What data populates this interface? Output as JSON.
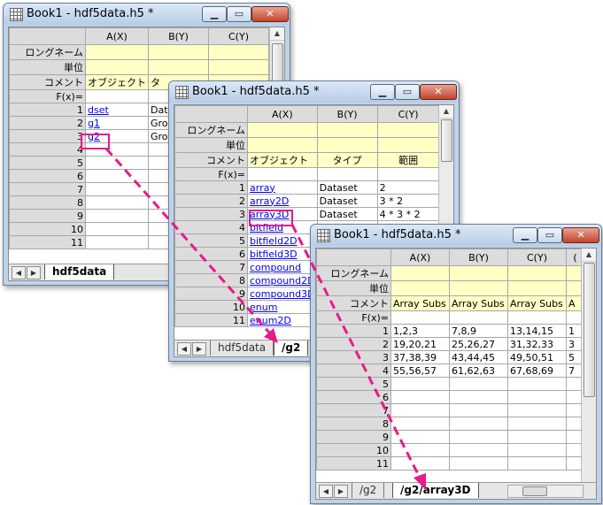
{
  "win1": {
    "title": "Book1 - hdf5data.h5 *",
    "minimize": "▁",
    "restore": "▭",
    "close": "✕",
    "cols": [
      "A(X)",
      "B(Y)",
      "C(Y)"
    ],
    "meta_labels": [
      "ロングネーム",
      "単位",
      "コメント",
      "F(x)="
    ],
    "comment_row": [
      "オブジェクト",
      "タ",
      ""
    ],
    "rows": [
      [
        "1",
        "dset",
        "Data",
        ""
      ],
      [
        "2",
        "g1",
        "Grou",
        ""
      ],
      [
        "3",
        "g2",
        "Grou",
        ""
      ],
      [
        "4",
        "",
        "",
        ""
      ],
      [
        "5",
        "",
        "",
        ""
      ],
      [
        "6",
        "",
        "",
        ""
      ],
      [
        "7",
        "",
        "",
        ""
      ],
      [
        "8",
        "",
        "",
        ""
      ],
      [
        "9",
        "",
        "",
        ""
      ],
      [
        "10",
        "",
        "",
        ""
      ],
      [
        "11",
        "",
        "",
        ""
      ]
    ],
    "tabs": [
      "hdf5data"
    ]
  },
  "win2": {
    "title": "Book1 - hdf5data.h5 *",
    "minimize": "▁",
    "restore": "▭",
    "close": "✕",
    "cols": [
      "A(X)",
      "B(Y)",
      "C(Y)"
    ],
    "meta_labels": [
      "ロングネーム",
      "単位",
      "コメント",
      "F(x)="
    ],
    "comment_row": [
      "オブジェクト",
      "タイプ",
      "範囲"
    ],
    "rows": [
      [
        "1",
        "array",
        "Dataset",
        "2"
      ],
      [
        "2",
        "array2D",
        "Dataset",
        "3 * 2"
      ],
      [
        "3",
        "array3D",
        "Dataset",
        "4 * 3 * 2"
      ],
      [
        "4",
        "bitfield",
        "",
        ""
      ],
      [
        "5",
        "bitfield2D",
        "",
        ""
      ],
      [
        "6",
        "bitfield3D",
        "",
        ""
      ],
      [
        "7",
        "compound",
        "",
        ""
      ],
      [
        "8",
        "compound2D",
        "",
        ""
      ],
      [
        "9",
        "compound3D",
        "",
        ""
      ],
      [
        "10",
        "enum",
        "",
        ""
      ],
      [
        "11",
        "enum2D",
        "",
        ""
      ]
    ],
    "tabs": [
      "hdf5data",
      "/g2"
    ]
  },
  "win3": {
    "title": "Book1 - hdf5data.h5 *",
    "minimize": "▁",
    "restore": "▭",
    "close": "✕",
    "cols": [
      "A(X)",
      "B(Y)",
      "C(Y)",
      "("
    ],
    "meta_labels": [
      "ロングネーム",
      "単位",
      "コメント",
      "F(x)="
    ],
    "comment_row": [
      "Array Subs",
      "Array Subs",
      "Array Subs",
      "A"
    ],
    "rows": [
      [
        "1",
        "1,2,3",
        "7,8,9",
        "13,14,15",
        "1"
      ],
      [
        "2",
        "19,20,21",
        "25,26,27",
        "31,32,33",
        "3"
      ],
      [
        "3",
        "37,38,39",
        "43,44,45",
        "49,50,51",
        "5"
      ],
      [
        "4",
        "55,56,57",
        "61,62,63",
        "67,68,69",
        "7"
      ],
      [
        "5",
        "",
        "",
        "",
        ""
      ],
      [
        "6",
        "",
        "",
        "",
        ""
      ],
      [
        "7",
        "",
        "",
        "",
        ""
      ],
      [
        "8",
        "",
        "",
        "",
        ""
      ],
      [
        "9",
        "",
        "",
        "",
        ""
      ],
      [
        "10",
        "",
        "",
        "",
        ""
      ],
      [
        "11",
        "",
        "",
        "",
        ""
      ]
    ],
    "tabs": [
      "/g2",
      "/g2/array3D"
    ]
  },
  "colors": {
    "highlight": "#e8198b",
    "meta_row": "#ffffc6",
    "header": "#dcdcdc",
    "link": "#0000ee"
  }
}
